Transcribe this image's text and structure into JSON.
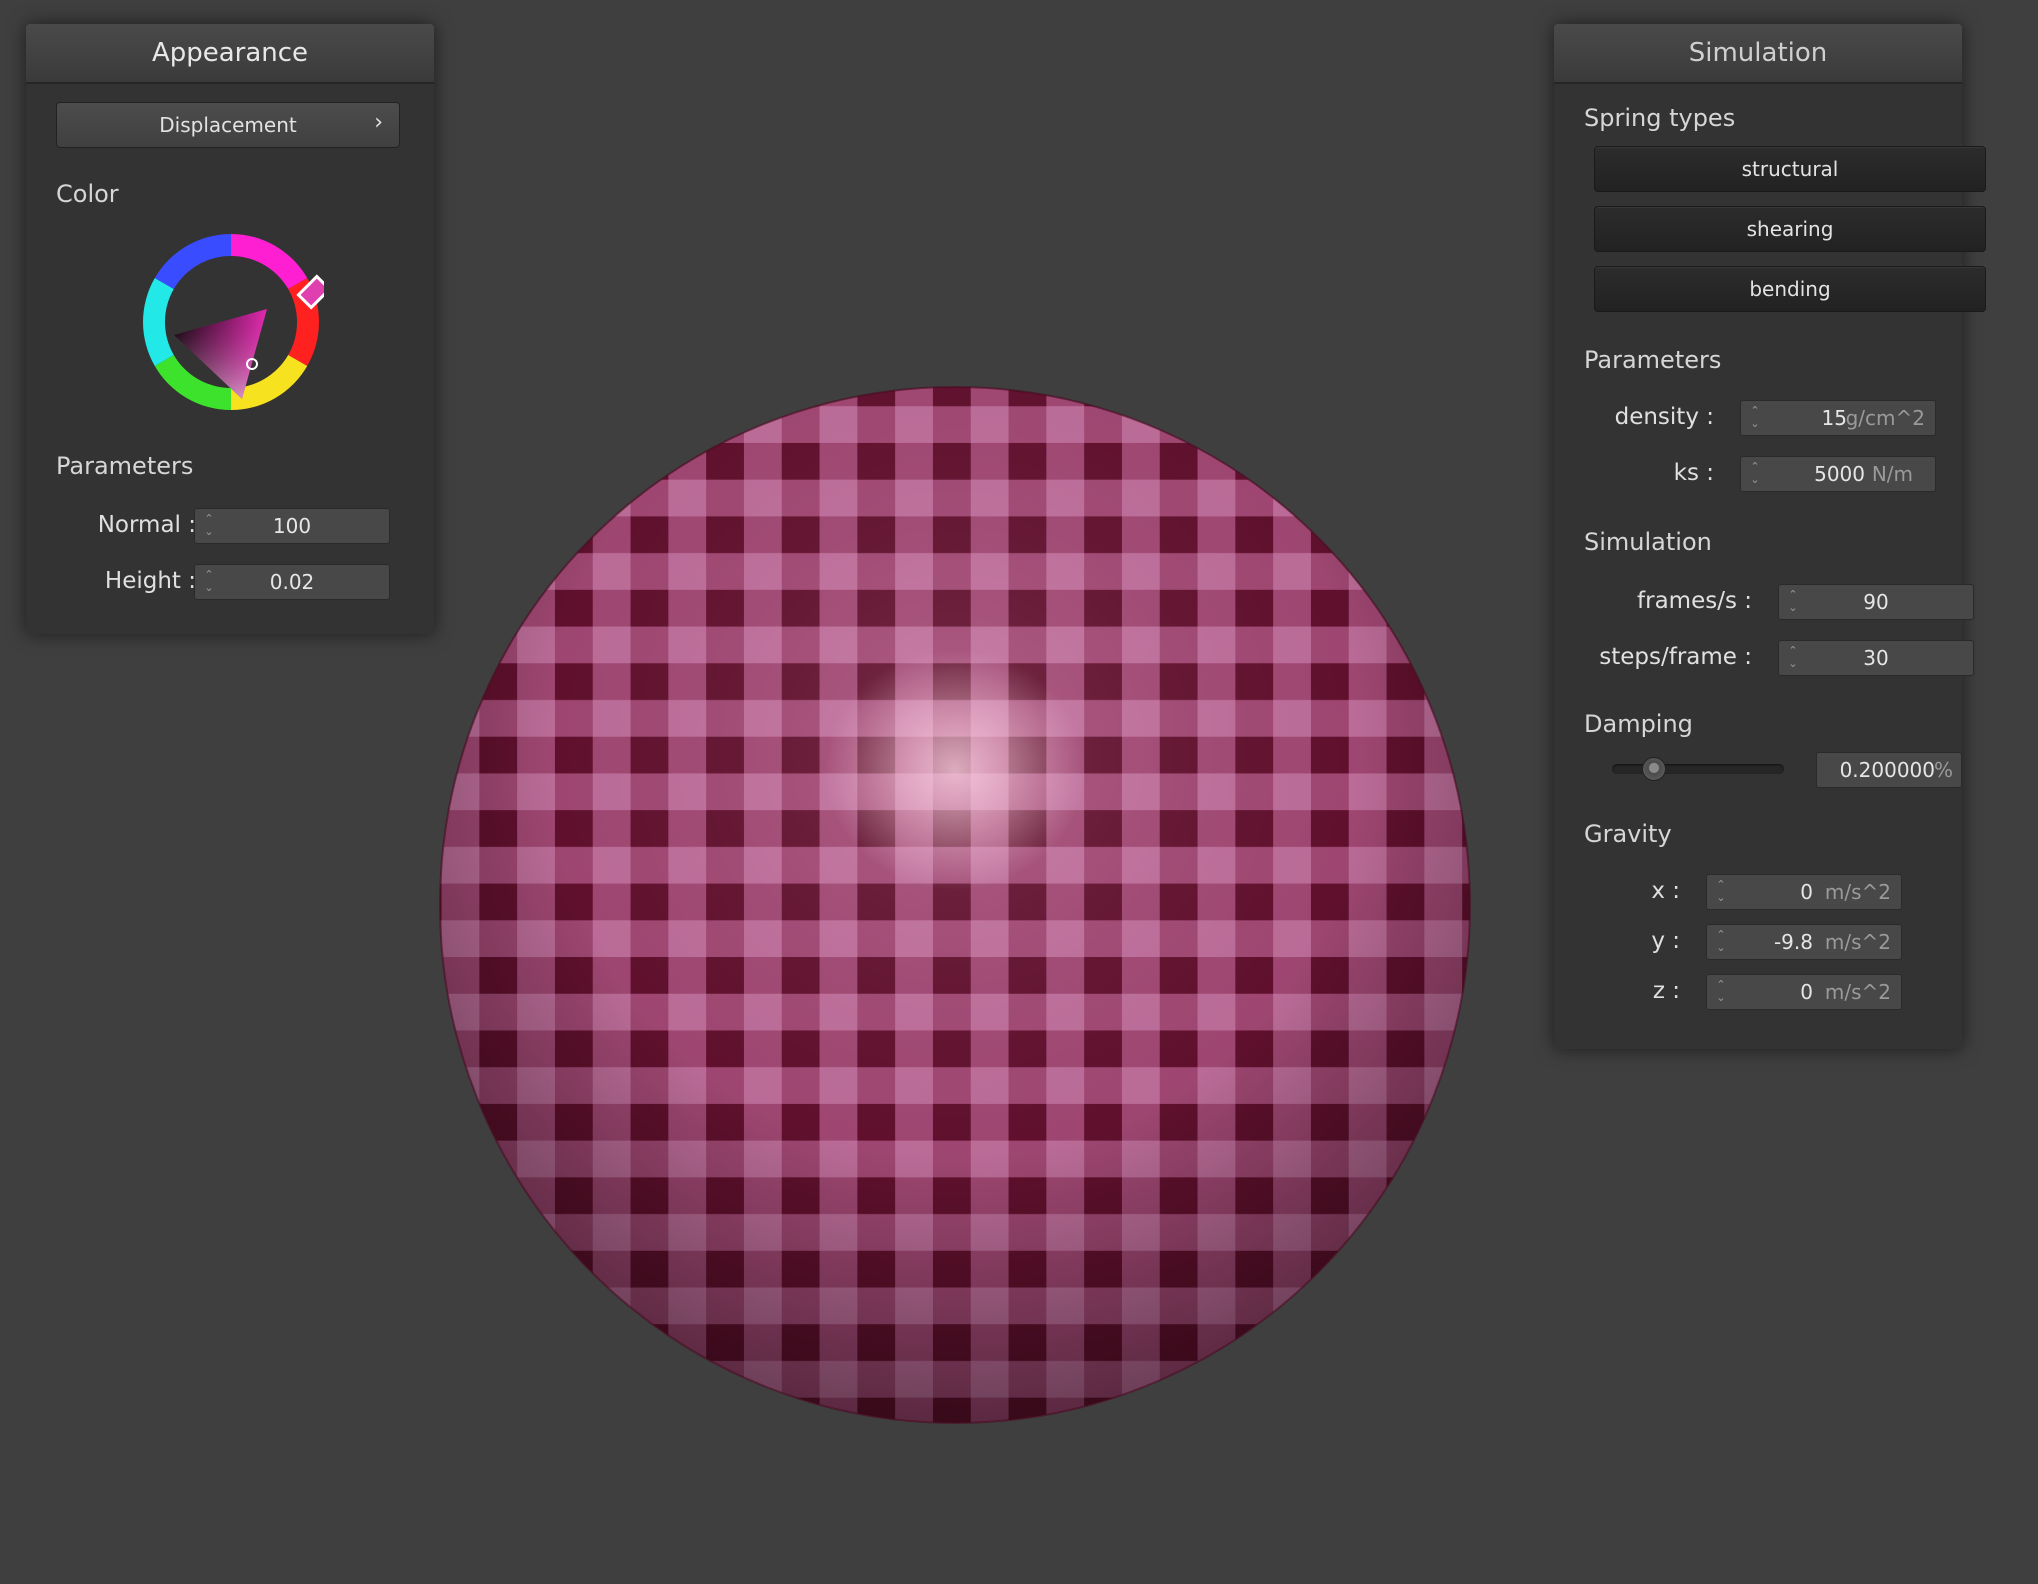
{
  "appearance": {
    "title": "Appearance",
    "texture_button": "Displacement",
    "texture_button_chevron": "›",
    "color_label": "Color",
    "parameters_label": "Parameters",
    "normal": {
      "label": "Normal :",
      "value": "100"
    },
    "height": {
      "label": "Height :",
      "value": "0.02"
    },
    "selected_color": "#c0398a"
  },
  "simulation": {
    "title": "Simulation",
    "spring_types_label": "Spring types",
    "spring_types": [
      "structural",
      "shearing",
      "bending"
    ],
    "parameters_label": "Parameters",
    "density": {
      "label": "density :",
      "value": "15",
      "unit": "g/cm^2"
    },
    "ks": {
      "label": "ks :",
      "value": "5000",
      "unit": "N/m"
    },
    "simulation_label": "Simulation",
    "frames_per_s": {
      "label": "frames/s :",
      "value": "90"
    },
    "steps_per_frame": {
      "label": "steps/frame :",
      "value": "30"
    },
    "damping_label": "Damping",
    "damping": {
      "value": "0.200000",
      "unit": "%",
      "slider_fraction": 0.2
    },
    "gravity_label": "Gravity",
    "gravity": {
      "x": {
        "label": "x :",
        "value": "0",
        "unit": "m/s^2"
      },
      "y": {
        "label": "y :",
        "value": "-9.8",
        "unit": "m/s^2"
      },
      "z": {
        "label": "z :",
        "value": "0",
        "unit": "m/s^2"
      }
    }
  },
  "viewport": {
    "object": "sphere",
    "light_color": "#c4719f",
    "dark_color": "#6a1030"
  }
}
